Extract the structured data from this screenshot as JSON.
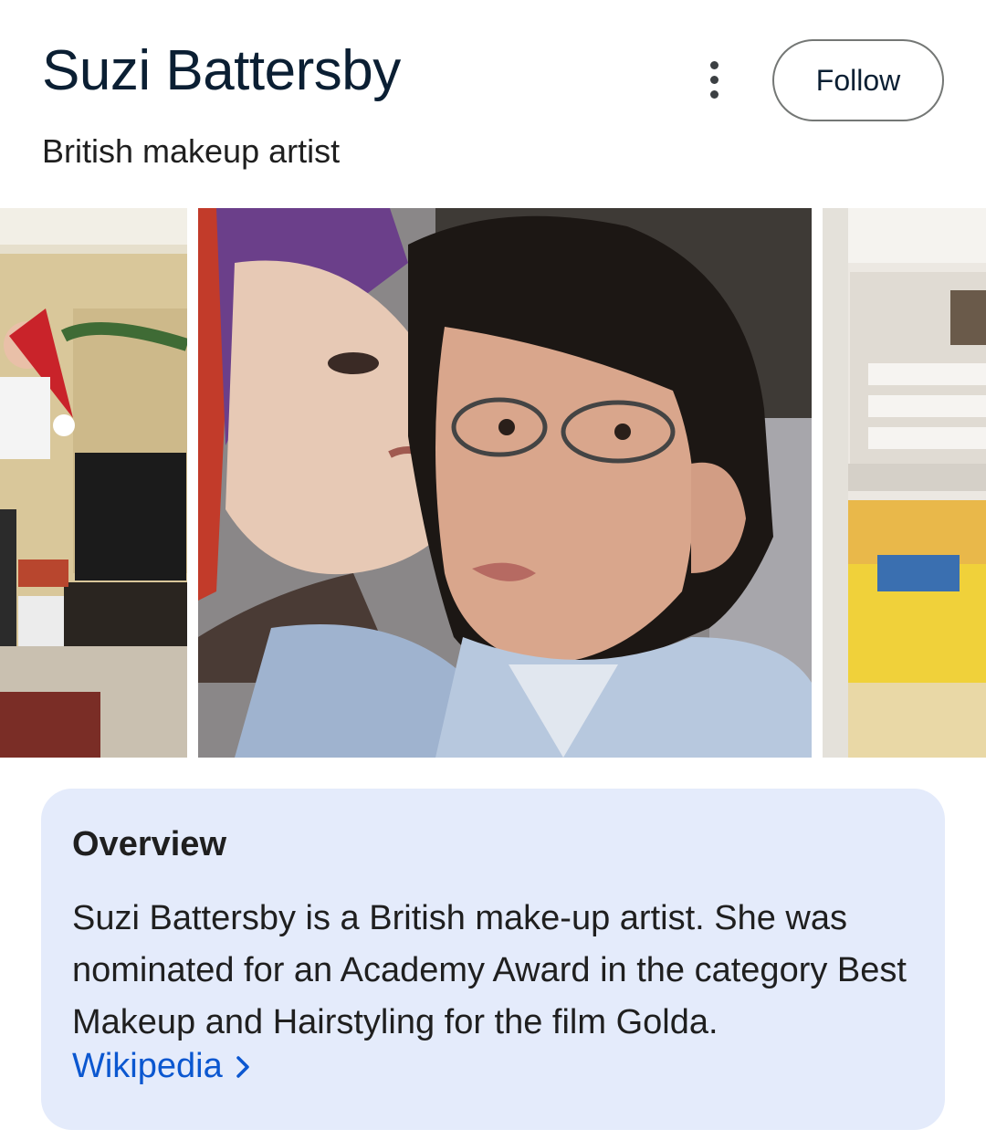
{
  "header": {
    "title": "Suzi Battersby",
    "subtitle": "British makeup artist",
    "follow_label": "Follow",
    "more_icon": "more-vert-icon"
  },
  "images": [
    {
      "name": "image-thumbnail-1"
    },
    {
      "name": "image-thumbnail-2"
    },
    {
      "name": "image-thumbnail-3"
    }
  ],
  "overview": {
    "heading": "Overview",
    "text": "Suzi Battersby is a British make-up artist. She was nominated for an Academy Award in the category Best Makeup and Hairstyling for the film Golda.",
    "source_label": "Wikipedia",
    "source_icon": "chevron-right-icon"
  },
  "colors": {
    "card_bg": "#e4ebfb",
    "link": "#0b57d0",
    "title": "#0b1f33"
  }
}
